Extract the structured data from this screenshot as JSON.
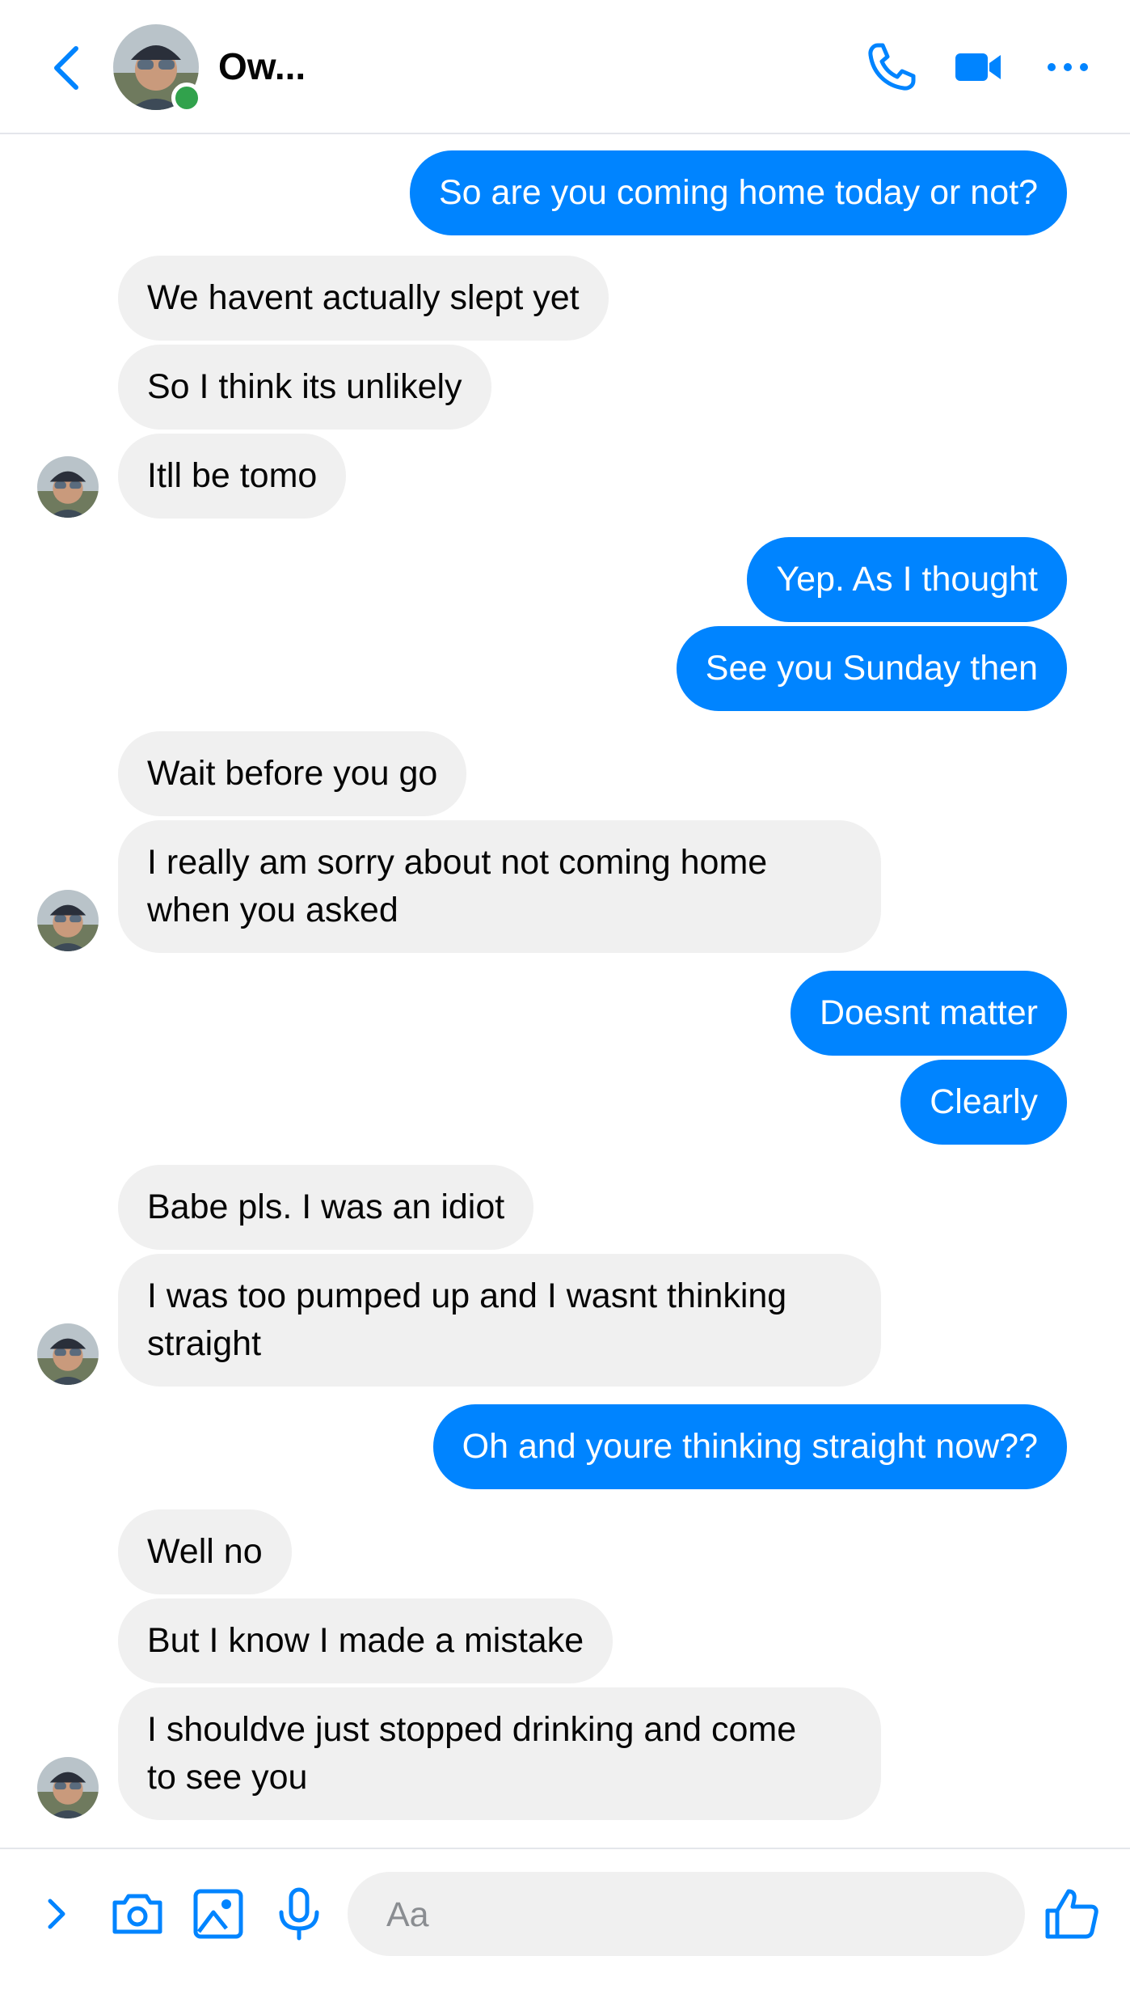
{
  "header": {
    "contact_name": "Ow...",
    "online": true
  },
  "messages": [
    {
      "id": "m1",
      "side": "out",
      "text": "So are you coming home today or not?"
    },
    {
      "id": "m2",
      "side": "in",
      "text": "We havent actually slept yet"
    },
    {
      "id": "m3",
      "side": "in",
      "text": "So I think its unlikely"
    },
    {
      "id": "m4",
      "side": "in",
      "text": "Itll be tomo"
    },
    {
      "id": "m5",
      "side": "out",
      "text": "Yep. As I thought"
    },
    {
      "id": "m6",
      "side": "out",
      "text": "See you Sunday then"
    },
    {
      "id": "m7",
      "side": "in",
      "text": "Wait before you go"
    },
    {
      "id": "m8",
      "side": "in",
      "text": "I really am sorry about not coming home\nwhen you asked"
    },
    {
      "id": "m9",
      "side": "out",
      "text": "Doesnt matter"
    },
    {
      "id": "m10",
      "side": "out",
      "text": "Clearly"
    },
    {
      "id": "m11",
      "side": "in",
      "text": "Babe pls. I was an idiot"
    },
    {
      "id": "m12",
      "side": "in",
      "text": "I was too pumped up and I wasnt thinking\nstraight"
    },
    {
      "id": "m13",
      "side": "out",
      "text": "Oh and youre thinking straight now??"
    },
    {
      "id": "m14",
      "side": "in",
      "text": "Well no"
    },
    {
      "id": "m15",
      "side": "in",
      "text": "But I know I made a mistake"
    },
    {
      "id": "m16",
      "side": "in",
      "text": "I shouldve just stopped drinking and come\nto see you"
    }
  ],
  "composer": {
    "placeholder": "Aa"
  },
  "colors": {
    "accent": "#0084ff",
    "incoming_bubble": "#f0f0f0",
    "online": "#31a24c"
  },
  "icons": {
    "header": [
      "chevron-left-icon",
      "phone-icon",
      "video-camera-icon",
      "more-icon"
    ],
    "composer": [
      "chevron-right-icon",
      "camera-icon",
      "image-icon",
      "microphone-icon",
      "thumbs-up-icon"
    ]
  }
}
